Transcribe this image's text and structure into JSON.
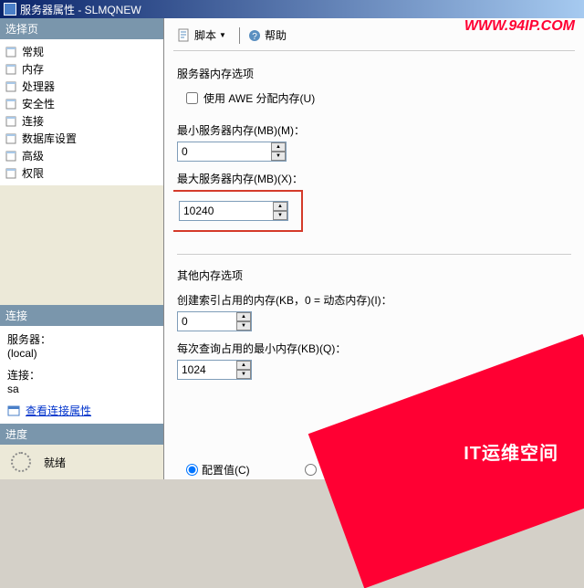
{
  "titlebar": {
    "text": "服务器属性 - SLMQNEW"
  },
  "sidebar": {
    "select_header": "选择页",
    "items": [
      {
        "label": "常规"
      },
      {
        "label": "内存"
      },
      {
        "label": "处理器"
      },
      {
        "label": "安全性"
      },
      {
        "label": "连接"
      },
      {
        "label": "数据库设置"
      },
      {
        "label": "高级"
      },
      {
        "label": "权限"
      }
    ],
    "conn_header": "连接",
    "conn_server_label": "服务器：",
    "conn_server_value": "(local)",
    "conn_login_label": "连接：",
    "conn_login_value": "sa",
    "conn_view_link": "查看连接属性",
    "progress_header": "进度",
    "progress_text": "就绪"
  },
  "toolbar": {
    "script": "脚本",
    "help": "帮助"
  },
  "content": {
    "server_mem_title": "服务器内存选项",
    "use_awe": "使用 AWE 分配内存(U)",
    "min_mem_label": "最小服务器内存(MB)(M)：",
    "min_mem_value": "0",
    "max_mem_label": "最大服务器内存(MB)(X)：",
    "max_mem_value": "10240",
    "other_title": "其他内存选项",
    "index_mem_label": "创建索引占用的内存(KB，0 = 动态内存)(I)：",
    "index_mem_value": "0",
    "query_mem_label": "每次查询占用的最小内存(KB)(Q)：",
    "query_mem_value": "1024",
    "radio_config": "配置值(C)",
    "radio_running": ""
  },
  "watermark": {
    "url": "WWW.94IP.COM",
    "text": "IT运维空间"
  }
}
